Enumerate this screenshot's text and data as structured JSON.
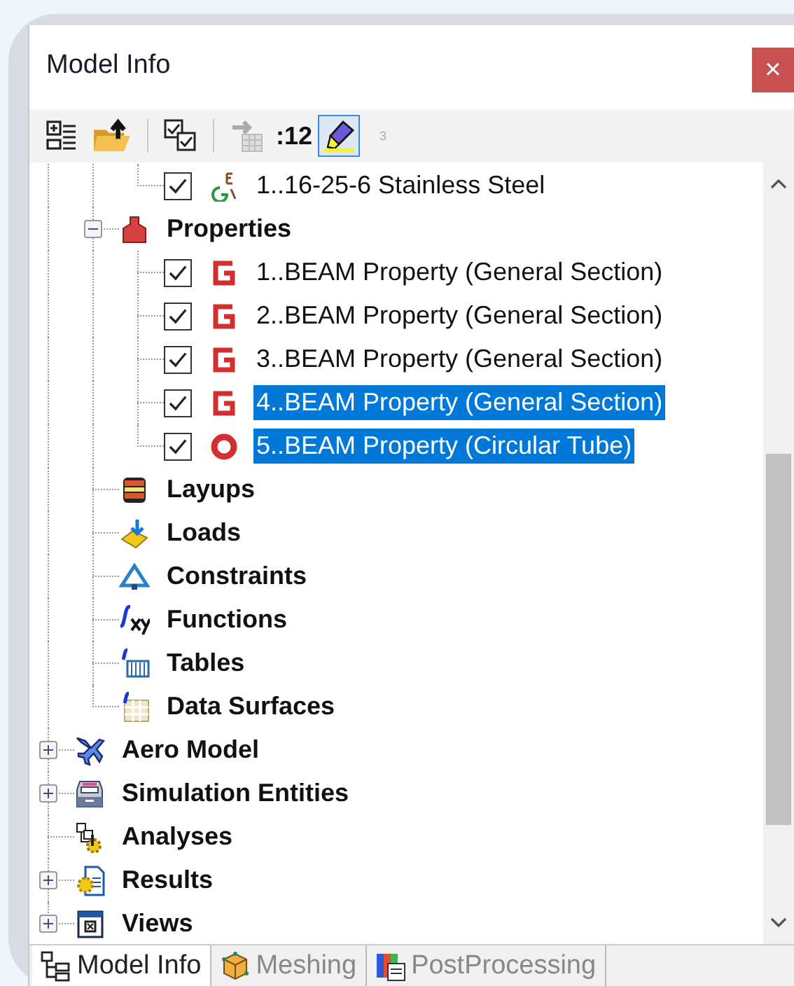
{
  "window": {
    "title": "Model Info",
    "close": "×"
  },
  "toolbar": {
    "counter": ":12",
    "highlight_pressed": true,
    "badge": "3"
  },
  "tree": [
    {
      "children": [
        {
          "children": [
            {
              "label": "1..16-25-6 Stainless Steel",
              "kind": "material",
              "checked": true,
              "selected": false
            }
          ]
        },
        {
          "label": "Properties",
          "kind": "properties",
          "expanded": true,
          "selected": false,
          "children": [
            {
              "label": "1..BEAM Property (General Section)",
              "kind": "section",
              "checked": true,
              "selected": false
            },
            {
              "label": "2..BEAM Property (General Section)",
              "kind": "section",
              "checked": true,
              "selected": false
            },
            {
              "label": "3..BEAM Property (General Section)",
              "kind": "section",
              "checked": true,
              "selected": false
            },
            {
              "label": "4..BEAM Property (General Section)",
              "kind": "section",
              "checked": true,
              "selected": true
            },
            {
              "label": "5..BEAM Property (Circular Tube)",
              "kind": "tube",
              "checked": true,
              "selected": true
            }
          ]
        },
        {
          "label": "Layups",
          "kind": "layups",
          "selected": false
        },
        {
          "label": "Loads",
          "kind": "loads",
          "selected": false
        },
        {
          "label": "Constraints",
          "kind": "constraints",
          "selected": false
        },
        {
          "label": "Functions",
          "kind": "functions",
          "selected": false
        },
        {
          "label": "Tables",
          "kind": "tables",
          "selected": false
        },
        {
          "label": "Data Surfaces",
          "kind": "surfaces",
          "selected": false
        }
      ]
    },
    {
      "label": "Aero Model",
      "kind": "aero",
      "expanded": false,
      "selected": false
    },
    {
      "label": "Simulation Entities",
      "kind": "sim",
      "expanded": false,
      "selected": false
    },
    {
      "label": "Analyses",
      "kind": "analyses",
      "selected": false
    },
    {
      "label": "Results",
      "kind": "results",
      "expanded": false,
      "selected": false
    },
    {
      "label": "Views",
      "kind": "views",
      "expanded": false,
      "selected": false
    }
  ],
  "tabs": [
    {
      "label": "Model Info",
      "kind": "tree",
      "selected": true
    },
    {
      "label": "Meshing",
      "kind": "cube",
      "selected": false
    },
    {
      "label": "PostProcessing",
      "kind": "post",
      "selected": false
    }
  ]
}
